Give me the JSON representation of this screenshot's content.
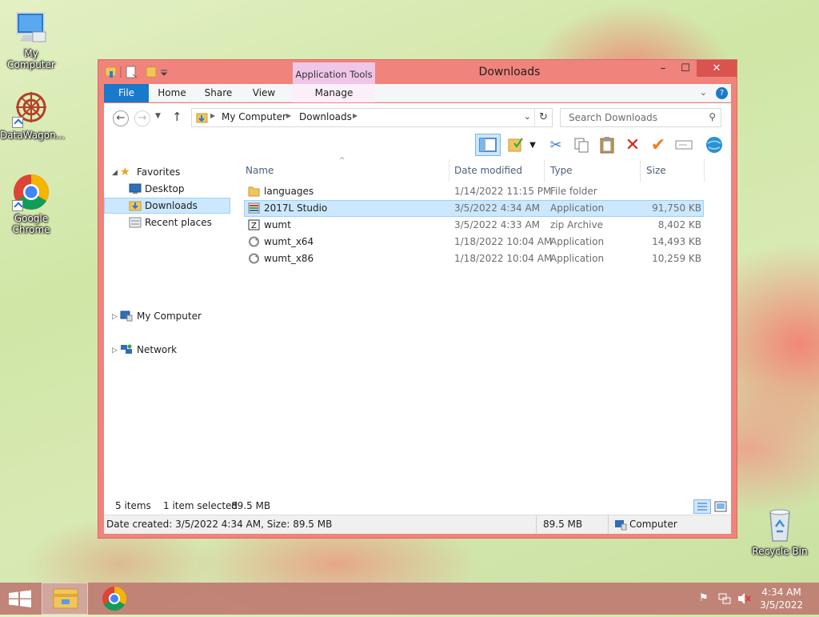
{
  "desktop": {
    "icons": [
      {
        "label": "My Computer"
      },
      {
        "label": "DataWagon..."
      },
      {
        "label": "Google Chrome"
      },
      {
        "label": "Recycle Bin"
      }
    ]
  },
  "window": {
    "title": "Downloads",
    "context_tab_group": "Application Tools",
    "controls": {
      "minimize": "–",
      "maximize": "☐",
      "close": "✕"
    },
    "ribbon_tabs": [
      "File",
      "Home",
      "Share",
      "View",
      "Manage"
    ]
  },
  "address": {
    "crumbs": [
      "My Computer",
      "Downloads"
    ],
    "search_placeholder": "Search Downloads"
  },
  "nav": {
    "favorites": "Favorites",
    "desktop": "Desktop",
    "downloads": "Downloads",
    "recent": "Recent places",
    "computer": "My Computer",
    "network": "Network"
  },
  "columns": {
    "name": "Name",
    "date": "Date modified",
    "type": "Type",
    "size": "Size"
  },
  "files": [
    {
      "name": "languages",
      "date": "1/14/2022 11:15 PM",
      "type": "File folder",
      "size": "",
      "icon": "folder-icon"
    },
    {
      "name": "2017L Studio",
      "date": "3/5/2022 4:34 AM",
      "type": "Application",
      "size": "91,750 KB",
      "icon": "installer-icon"
    },
    {
      "name": "wumt",
      "date": "3/5/2022 4:33 AM",
      "type": "zip Archive",
      "size": "8,402 KB",
      "icon": "zip-archive-icon"
    },
    {
      "name": "wumt_x64",
      "date": "1/18/2022 10:04 AM",
      "type": "Application",
      "size": "14,493 KB",
      "icon": "application-icon"
    },
    {
      "name": "wumt_x86",
      "date": "1/18/2022 10:04 AM",
      "type": "Application",
      "size": "10,259 KB",
      "icon": "application-icon"
    }
  ],
  "status": {
    "count": "5 items",
    "selected": "1 item selected",
    "selected_size": "89.5 MB"
  },
  "details": {
    "info": "Date created: 3/5/2022 4:34 AM, Size: 89.5 MB",
    "size": "89.5 MB",
    "location": "Computer"
  },
  "clock": {
    "time": "4:34 AM",
    "date": "3/5/2022"
  }
}
